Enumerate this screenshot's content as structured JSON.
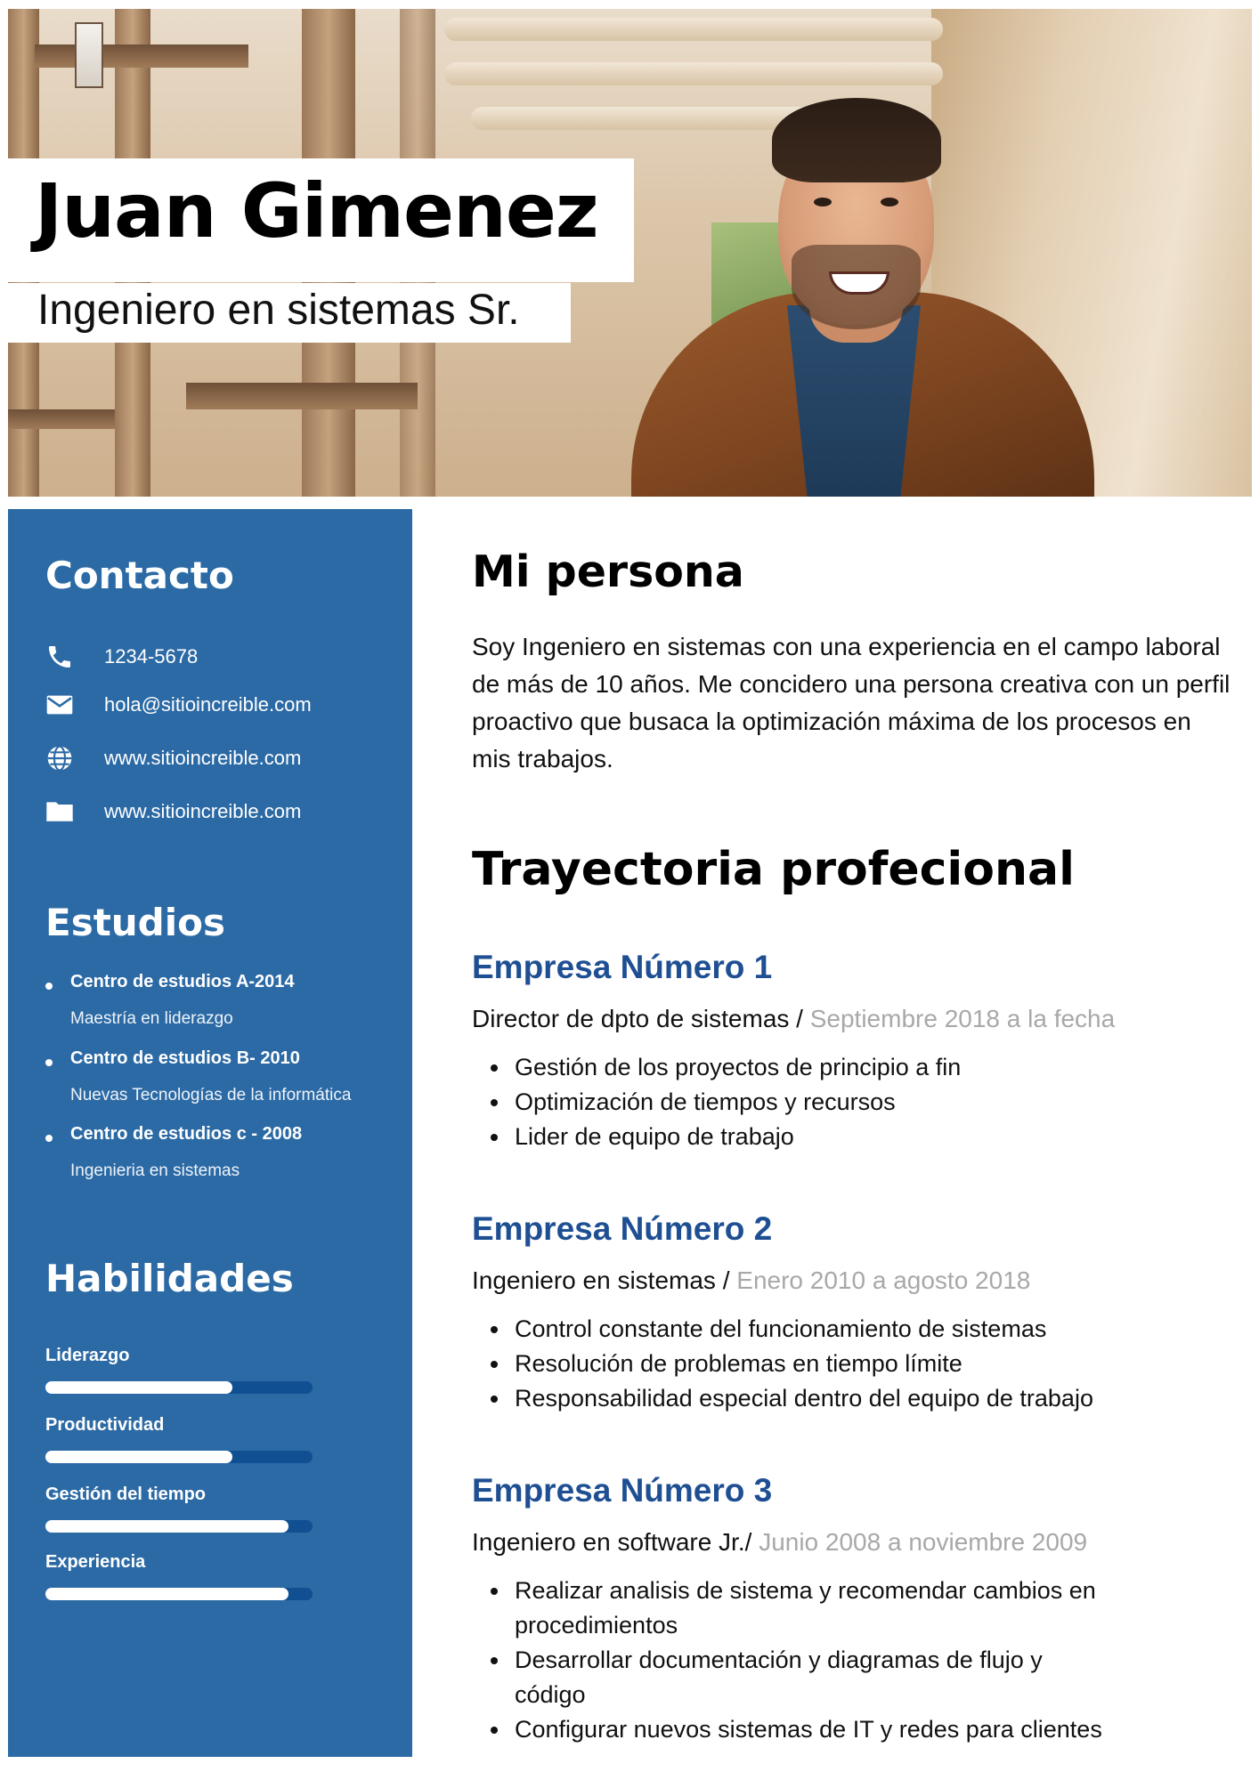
{
  "header": {
    "name": "Juan Gimenez",
    "title": "Ingeniero en sistemas Sr."
  },
  "sidebar": {
    "contact": {
      "heading": "Contacto",
      "items": [
        {
          "icon": "phone-icon",
          "text": "1234-5678"
        },
        {
          "icon": "email-icon",
          "text": "hola@sitioincreible.com"
        },
        {
          "icon": "globe-icon",
          "text": "www.sitioincreible.com"
        },
        {
          "icon": "folder-icon",
          "text": "www.sitioincreible.com"
        }
      ]
    },
    "education": {
      "heading": "Estudios",
      "items": [
        {
          "school": "Centro de estudios A-2014",
          "degree": "Maestría en liderazgo"
        },
        {
          "school": "Centro de estudios B- 2010",
          "degree": "Nuevas Tecnologías de la informática"
        },
        {
          "school": "Centro de estudios c - 2008",
          "degree": "Ingenieria en sistemas"
        }
      ]
    },
    "skills": {
      "heading": "Habilidades",
      "items": [
        {
          "label": "Liderazgo",
          "level": 0.7
        },
        {
          "label": "Productividad",
          "level": 0.7
        },
        {
          "label": "Gestión del tiempo",
          "level": 0.91
        },
        {
          "label": "Experiencia",
          "level": 0.91
        }
      ]
    }
  },
  "main": {
    "about": {
      "heading": "Mi persona",
      "text": "Soy Ingeniero en sistemas con una experiencia en el campo laboral de más de 10 años. Me concidero una persona creativa con un perfil proactivo que busaca la optimización máxima de los procesos en mis trabajos."
    },
    "career": {
      "heading": "Trayectoria profecional",
      "jobs": [
        {
          "company": "Empresa Número 1",
          "role": "Director de dpto de sistemas /",
          "dates": "Septiembre 2018 a la fecha",
          "bullets": [
            "Gestión de los proyectos de principio a fin",
            "Optimización de tiempos y recursos",
            "Lider de equipo de trabajo"
          ]
        },
        {
          "company": "Empresa Número 2",
          "role": "Ingeniero en sistemas /",
          "dates": "Enero 2010 a agosto 2018",
          "bullets": [
            "Control constante del funcionamiento de sistemas",
            "Resolución de problemas en tiempo límite",
            "Responsabilidad especial dentro del equipo de trabajo"
          ]
        },
        {
          "company": "Empresa Número 3",
          "role": "Ingeniero en software Jr./",
          "dates": "Junio 2008 a noviembre 2009",
          "bullets": [
            "Realizar analisis de sistema y recomendar cambios en procedimientos",
            "Desarrollar documentación y diagramas de flujo y código",
            "Configurar nuevos sistemas de IT y redes para clientes"
          ]
        }
      ]
    }
  },
  "colors": {
    "sidebar": "#2c6aa5",
    "accent": "#1f4f93",
    "skill_track": "#0f4f92",
    "date_gray": "#a8a8a8"
  }
}
